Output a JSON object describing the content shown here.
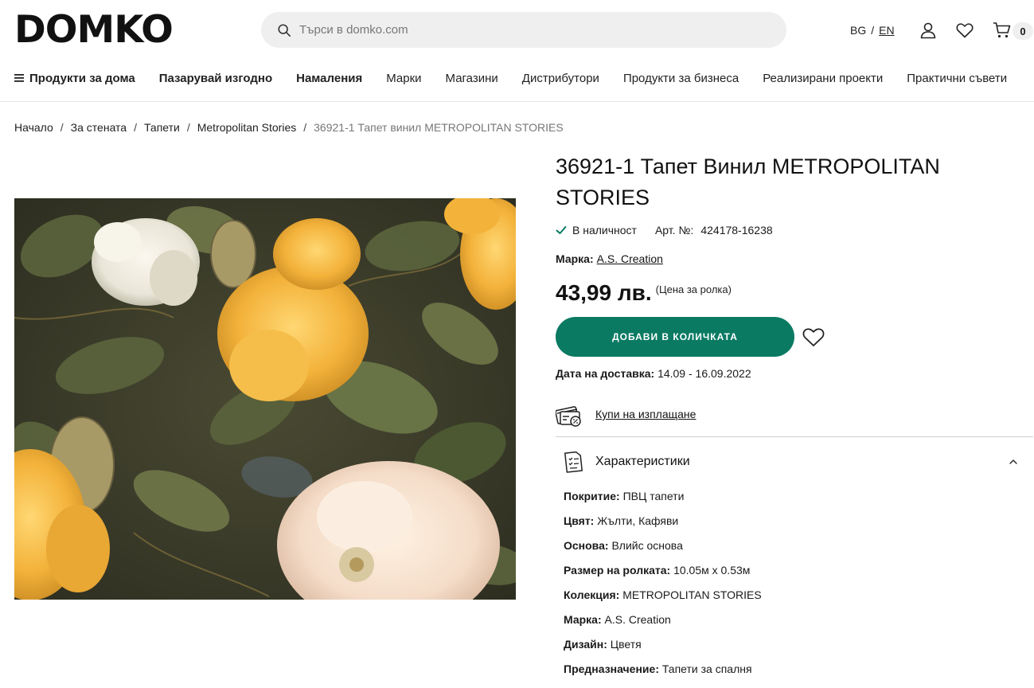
{
  "header": {
    "logo": "DOMKO",
    "search_placeholder": "Търси в domko.com",
    "lang_bg": "BG",
    "lang_sep": "/",
    "lang_en": "EN",
    "cart_count": "0"
  },
  "nav": [
    {
      "label": "Продукти за дома",
      "bold": true
    },
    {
      "label": "Пазарувай изгодно",
      "bold": true
    },
    {
      "label": "Намаления",
      "bold": true
    },
    {
      "label": "Марки",
      "bold": false
    },
    {
      "label": "Магазини",
      "bold": false
    },
    {
      "label": "Дистрибутори",
      "bold": false
    },
    {
      "label": "Продукти за бизнеса",
      "bold": false
    },
    {
      "label": "Реализирани проекти",
      "bold": false
    },
    {
      "label": "Практични съвети",
      "bold": false
    }
  ],
  "breadcrumb": [
    "Начало",
    "За стената",
    "Тапети",
    "Metropolitan Stories",
    "36921-1 Тапет винил METROPOLITAN STORIES"
  ],
  "breadcrumb_sep": "/",
  "product": {
    "title": "36921-1 Тапет Винил METROPOLITAN STORIES",
    "stock": "В наличност",
    "art_label": "Арт. №:",
    "art_value": "424178-16238",
    "brand_label": "Марка:",
    "brand_value": "A.S. Creation",
    "price": "43,99 лв.",
    "price_note": "(Цена за ролка)",
    "add_to_cart": "ДОБАВИ В КОЛИЧКАТА",
    "delivery_label": "Дата на доставка:",
    "delivery_value": "14.09 - 16.09.2022",
    "installment": "Купи на изплащане",
    "specs_title": "Характеристики",
    "specs": [
      {
        "k": "Покритие:",
        "v": "ПВЦ тапети"
      },
      {
        "k": "Цвят:",
        "v": "Жълти, Кафяви"
      },
      {
        "k": "Основа:",
        "v": "Влийс основа"
      },
      {
        "k": "Размер на ролката:",
        "v": "10.05м х 0.53м"
      },
      {
        "k": "Колекция:",
        "v": "METROPOLITAN STORIES"
      },
      {
        "k": "Марка:",
        "v": "A.S. Creation"
      },
      {
        "k": "Дизайн:",
        "v": "Цветя"
      },
      {
        "k": "Предназначение:",
        "v": "Тапети за спалня"
      }
    ]
  },
  "colors": {
    "accent": "#0a7a63",
    "search_bg": "#efefef",
    "flower_yellow": "#f2b53a",
    "leaf_dark": "#3d4a2a"
  },
  "icons": [
    "search-icon",
    "user-icon",
    "heart-icon",
    "cart-icon",
    "menu-icon",
    "check-icon",
    "card-icon",
    "specs-doc-icon",
    "chevron-up-icon"
  ]
}
